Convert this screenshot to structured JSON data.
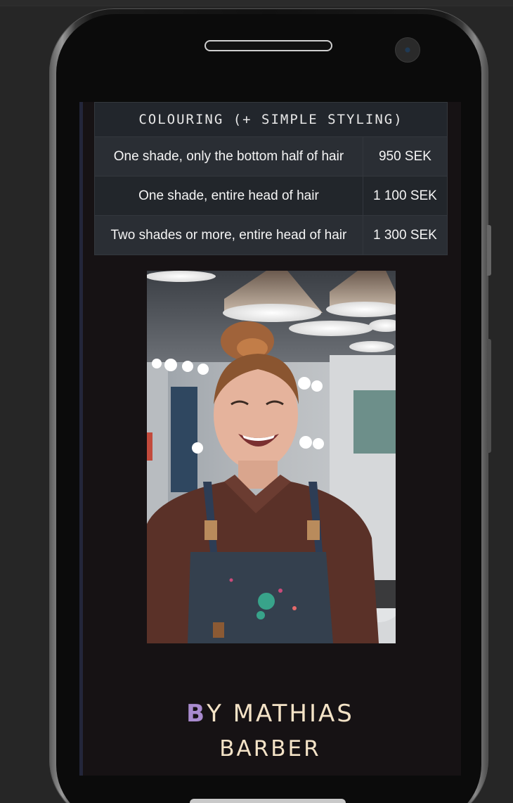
{
  "price_table": {
    "header": "COLOURING (+ SIMPLE STYLING)",
    "rows": [
      {
        "service": "One shade, only the bottom half of hair",
        "price": "950 SEK"
      },
      {
        "service": "One shade, entire head of hair",
        "price": "1 100 SEK"
      },
      {
        "service": "Two shades or more, entire head of hair",
        "price": "1 300 SEK"
      }
    ]
  },
  "photo": {
    "icon": "barber-portrait-photo"
  },
  "brand": {
    "initial": "B",
    "line1_rest": "Y MATHIAS",
    "line2": "BARBER",
    "accent_color": "#a98bcf",
    "text_color": "#f4e3c7"
  }
}
